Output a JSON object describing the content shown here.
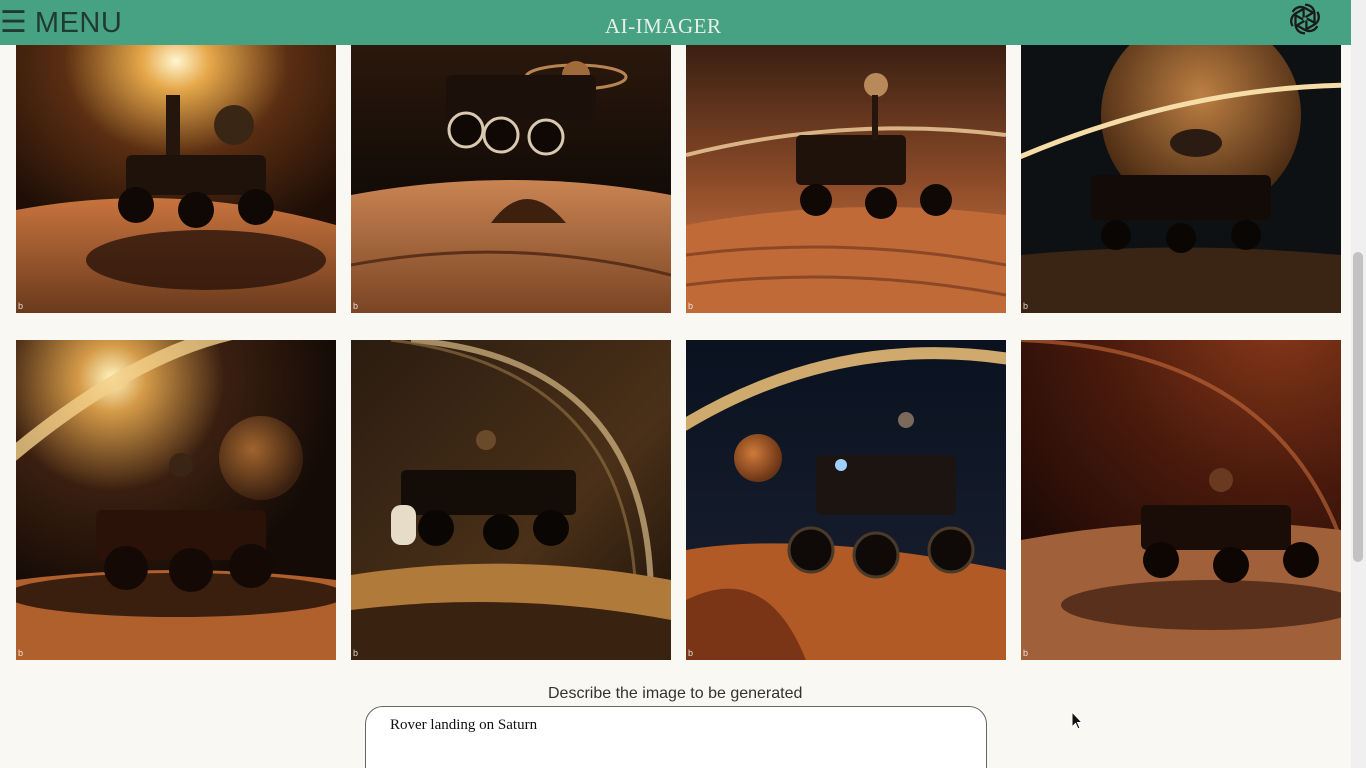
{
  "header": {
    "menu_icon": "☰",
    "menu_label": "MENU",
    "title": "AI-IMAGER",
    "logo_icon": "openai-logo-icon",
    "background_color": "#47a283"
  },
  "gallery": {
    "images": [
      {
        "name": "rover-image-1",
        "badge": "b"
      },
      {
        "name": "rover-image-2",
        "badge": "b"
      },
      {
        "name": "rover-image-3",
        "badge": "b"
      },
      {
        "name": "rover-image-4",
        "badge": "b"
      },
      {
        "name": "rover-image-5",
        "badge": "b"
      },
      {
        "name": "rover-image-6",
        "badge": "b"
      },
      {
        "name": "rover-image-7",
        "badge": "b"
      },
      {
        "name": "rover-image-8",
        "badge": "b"
      }
    ]
  },
  "prompt": {
    "label": "Describe the image to be generated",
    "value": "Rover landing on Saturn"
  }
}
